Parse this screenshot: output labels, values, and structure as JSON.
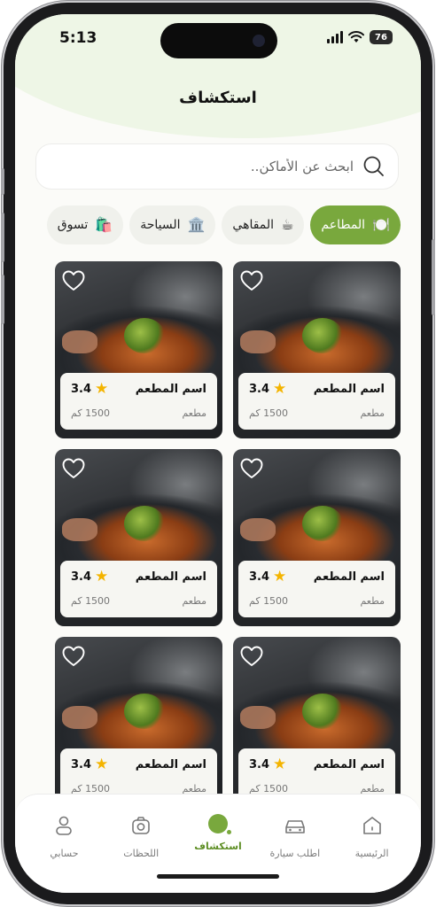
{
  "status_bar": {
    "time": "5:13",
    "battery": "76"
  },
  "header": {
    "title": "استكشاف"
  },
  "search": {
    "placeholder": "ابحث عن الأماكن.."
  },
  "categories": [
    {
      "label": "المطاعم",
      "icon": "plate-icon",
      "glyph": "🍽️",
      "active": true
    },
    {
      "label": "المقاهي",
      "icon": "coffee-icon",
      "glyph": "☕",
      "active": false
    },
    {
      "label": "السياحة",
      "icon": "landmark-icon",
      "glyph": "🏛️",
      "active": false
    },
    {
      "label": "تسوق",
      "icon": "shopping-bag-icon",
      "glyph": "🛍️",
      "active": false
    }
  ],
  "places": [
    {
      "name": "اسم المطعم",
      "rating": "3.4",
      "type": "مطعم",
      "distance": "1500 كم"
    },
    {
      "name": "اسم المطعم",
      "rating": "3.4",
      "type": "مطعم",
      "distance": "1500 كم"
    },
    {
      "name": "اسم المطعم",
      "rating": "3.4",
      "type": "مطعم",
      "distance": "1500 كم"
    },
    {
      "name": "اسم المطعم",
      "rating": "3.4",
      "type": "مطعم",
      "distance": "1500 كم"
    },
    {
      "name": "اسم المطعم",
      "rating": "3.4",
      "type": "مطعم",
      "distance": "1500 كم"
    },
    {
      "name": "اسم المطعم",
      "rating": "3.4",
      "type": "مطعم",
      "distance": "1500 كم"
    }
  ],
  "nav": [
    {
      "label": "الرئيسية",
      "icon": "home-icon"
    },
    {
      "label": "اطلب سيارة",
      "icon": "car-icon"
    },
    {
      "label": "استكشاف",
      "icon": "explore-icon",
      "active": true
    },
    {
      "label": "اللحظات",
      "icon": "camera-icon"
    },
    {
      "label": "حسابي",
      "icon": "user-icon"
    }
  ],
  "colors": {
    "accent": "#79a83d",
    "star": "#f4b400",
    "background": "#fbfbf8"
  }
}
